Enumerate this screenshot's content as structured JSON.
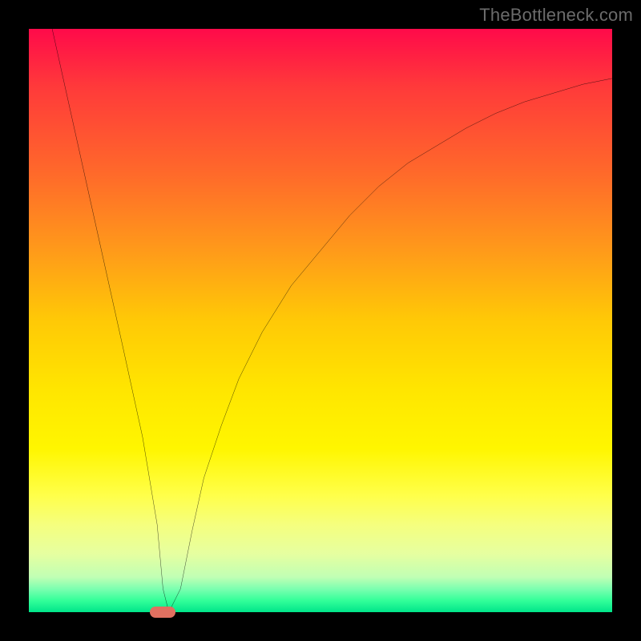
{
  "watermark": "TheBottleneck.com",
  "chart_data": {
    "type": "line",
    "title": "",
    "xlabel": "",
    "ylabel": "",
    "xlim": [
      0,
      100
    ],
    "ylim": [
      0,
      100
    ],
    "grid": false,
    "legend": false,
    "series": [
      {
        "name": "curve",
        "x": [
          4,
          8,
          12,
          16,
          19.5,
          22,
          23,
          24,
          26,
          28,
          30,
          33,
          36,
          40,
          45,
          50,
          55,
          60,
          65,
          70,
          75,
          80,
          85,
          90,
          95,
          100
        ],
        "y": [
          100,
          82,
          64,
          46,
          30,
          15,
          4,
          0,
          4,
          14,
          23,
          32,
          40,
          48,
          56,
          62,
          68,
          73,
          77,
          80,
          83,
          85.5,
          87.5,
          89,
          90.5,
          91.5
        ]
      }
    ],
    "marker": {
      "x": 23,
      "y": 0,
      "color": "#e07060"
    },
    "background": "rainbow-vertical-gradient"
  }
}
